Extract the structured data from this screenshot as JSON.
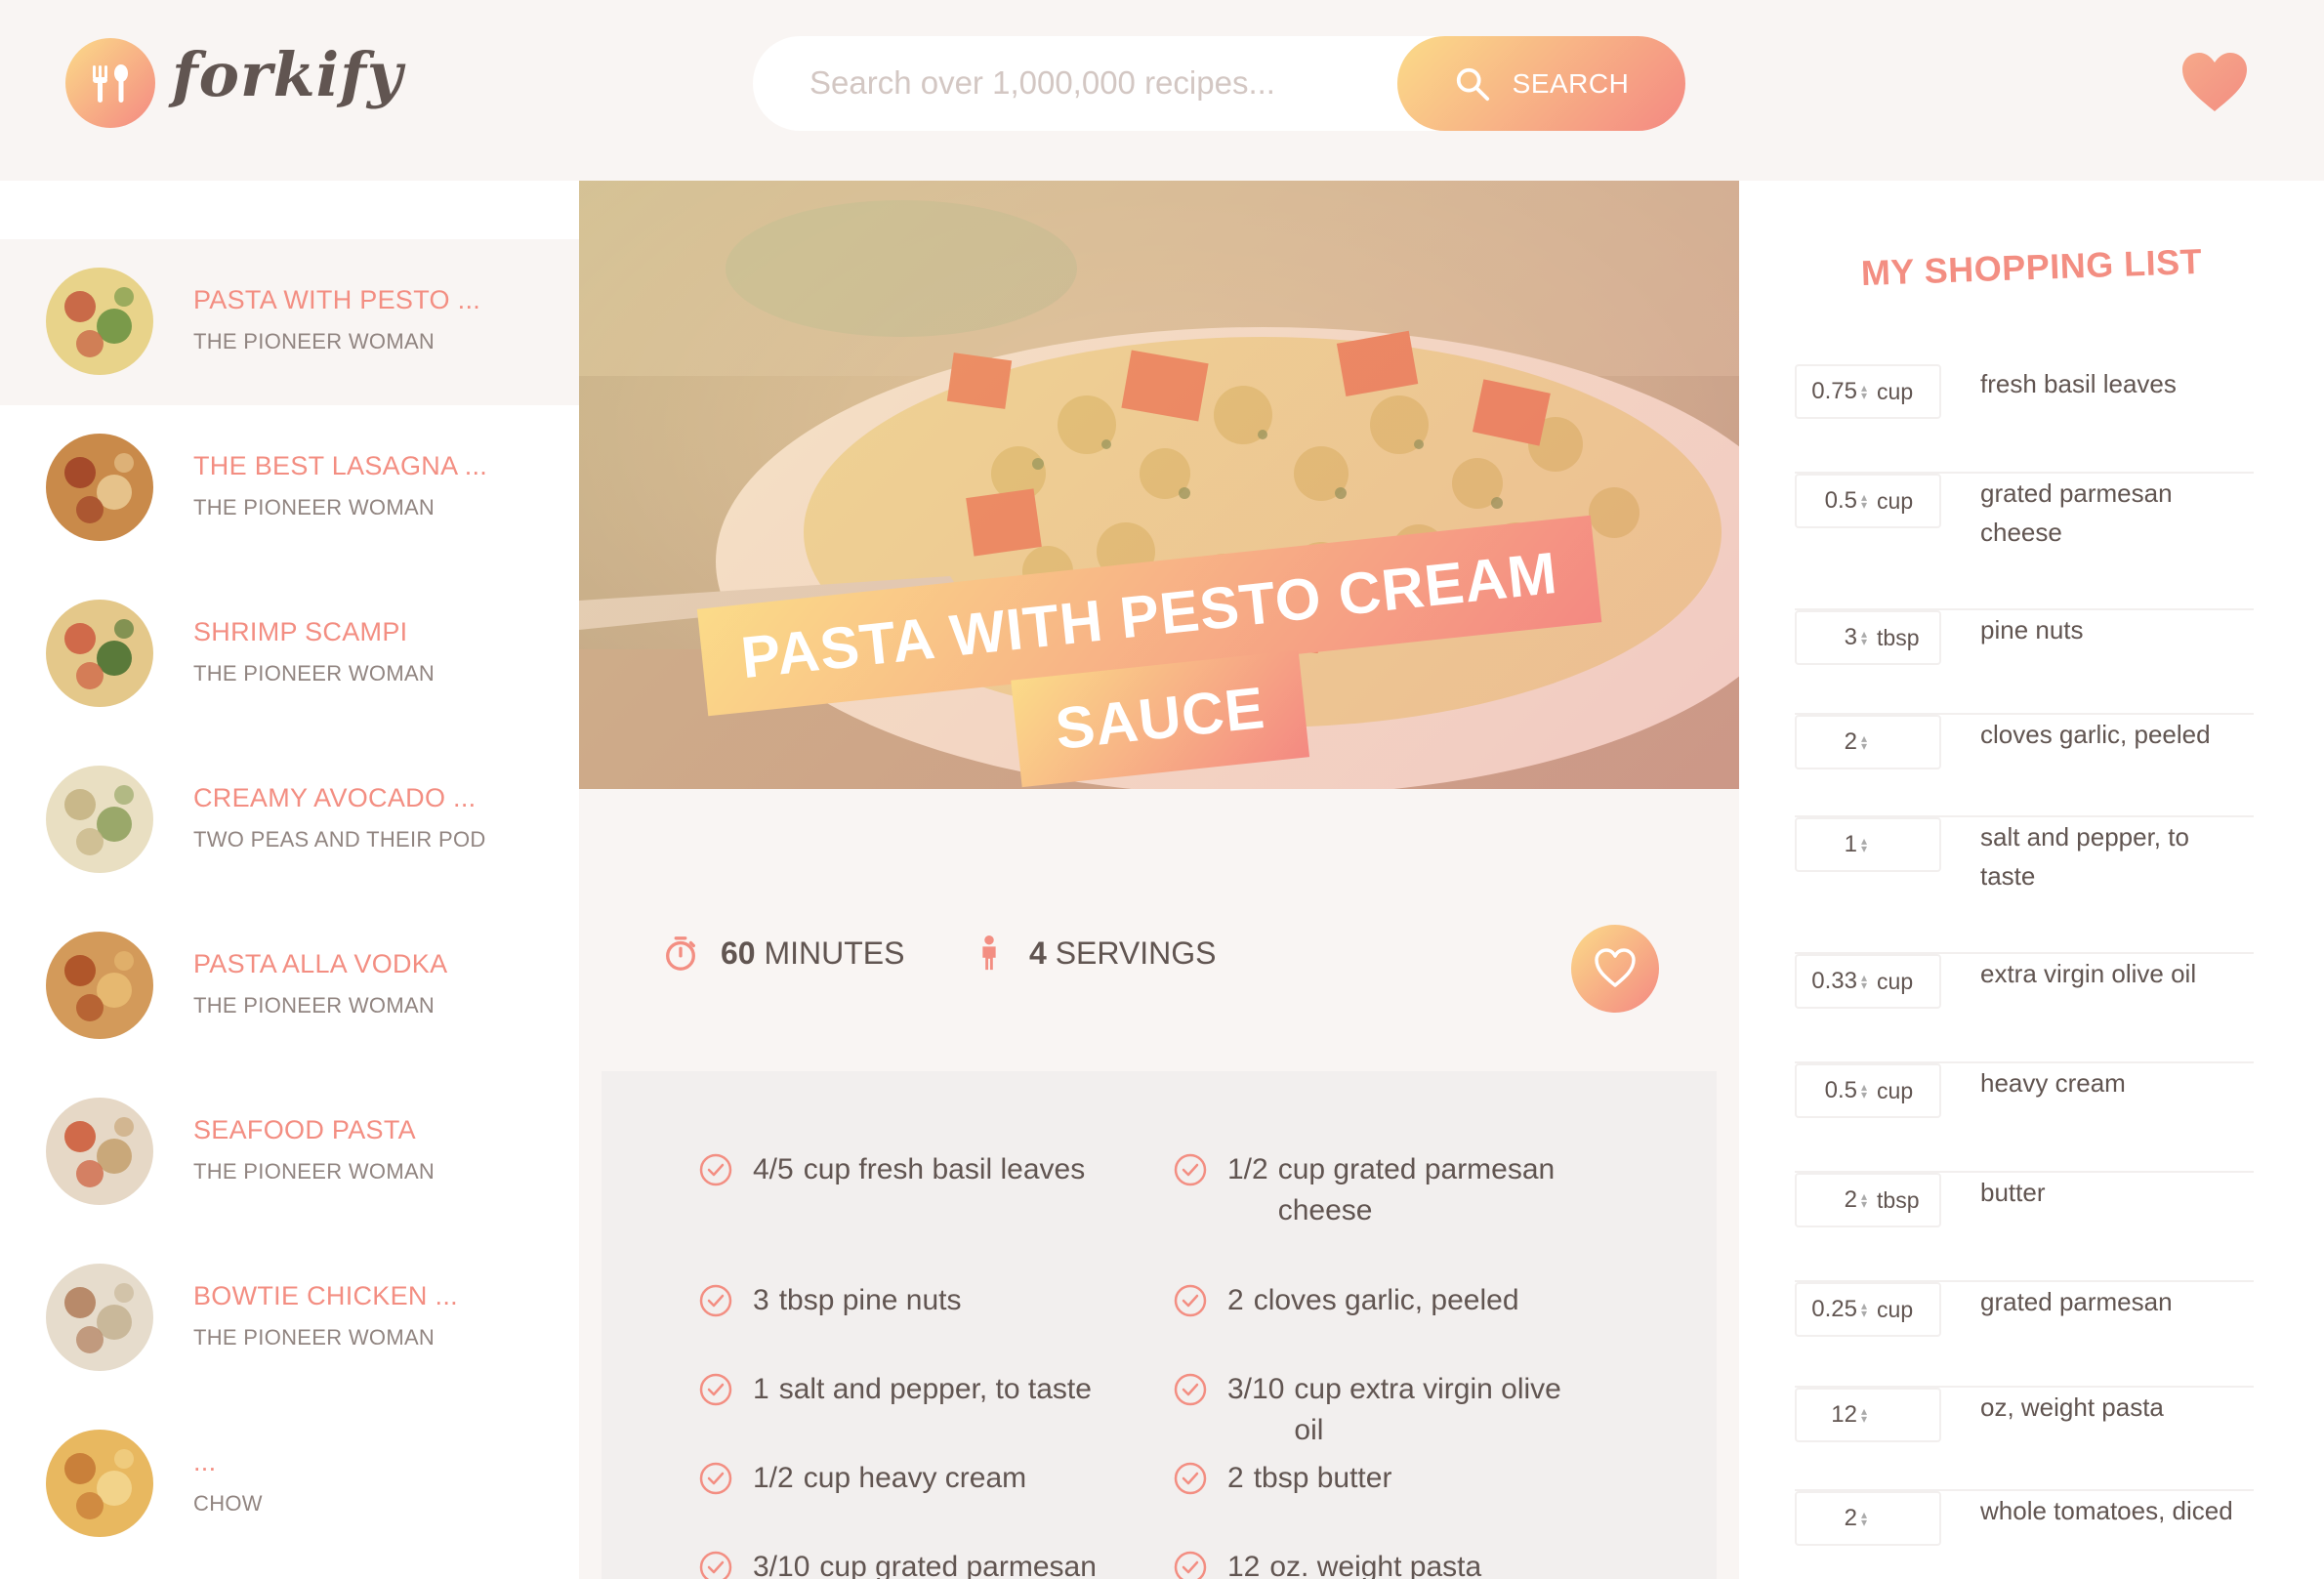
{
  "header": {
    "logo_text": "forkify",
    "search_placeholder": "Search over 1,000,000 recipes...",
    "search_button": "Search"
  },
  "results": [
    {
      "title": "Pasta with pesto ...",
      "author": "The Pioneer Woman",
      "active": true
    },
    {
      "title": "The Best Lasagna ...",
      "author": "The Pioneer Woman"
    },
    {
      "title": "Shrimp Scampi",
      "author": "The Pioneer Woman"
    },
    {
      "title": "Creamy Avocado ...",
      "author": "Two Peas and Their Pod"
    },
    {
      "title": "Pasta Alla Vodka",
      "author": "The Pioneer Woman"
    },
    {
      "title": "Seafood Pasta",
      "author": "The Pioneer Woman"
    },
    {
      "title": "Bowtie Chicken ...",
      "author": "The Pioneer Woman"
    },
    {
      "title": "...",
      "author": "Chow"
    }
  ],
  "recipe": {
    "title_line1": "Pasta with Pesto Cream",
    "title_line2": "Sauce",
    "minutes": "60",
    "minutes_label": "minutes",
    "servings": "4",
    "servings_label": "servings",
    "ingredients": [
      {
        "qty": "4/5",
        "text": "cup fresh basil leaves"
      },
      {
        "qty": "1/2",
        "text": "cup grated parmesan cheese"
      },
      {
        "qty": "3",
        "text": "tbsp pine nuts"
      },
      {
        "qty": "2",
        "text": "cloves garlic, peeled"
      },
      {
        "qty": "1",
        "text": "salt and pepper, to taste"
      },
      {
        "qty": "3/10",
        "text": "cup extra virgin olive oil"
      },
      {
        "qty": "1/2",
        "text": "cup heavy cream"
      },
      {
        "qty": "2",
        "text": "tbsp butter"
      },
      {
        "qty": "3/10",
        "text": "cup grated parmesan"
      },
      {
        "qty": "12",
        "text": "oz. weight pasta"
      }
    ]
  },
  "shopping": {
    "title": "My Shopping List",
    "items": [
      {
        "count": "0.75",
        "unit": "cup",
        "desc": "fresh basil leaves"
      },
      {
        "count": "0.5",
        "unit": "cup",
        "desc": "grated parmesan cheese"
      },
      {
        "count": "3",
        "unit": "tbsp",
        "desc": "pine nuts"
      },
      {
        "count": "2",
        "unit": "",
        "desc": "cloves garlic, peeled"
      },
      {
        "count": "1",
        "unit": "",
        "desc": "salt and pepper, to taste"
      },
      {
        "count": "0.33",
        "unit": "cup",
        "desc": "extra virgin olive oil"
      },
      {
        "count": "0.5",
        "unit": "cup",
        "desc": "heavy cream"
      },
      {
        "count": "2",
        "unit": "tbsp",
        "desc": "butter"
      },
      {
        "count": "0.25",
        "unit": "cup",
        "desc": "grated parmesan"
      },
      {
        "count": "12",
        "unit": "",
        "desc": "oz, weight pasta"
      },
      {
        "count": "2",
        "unit": "",
        "desc": "whole tomatoes, diced"
      }
    ]
  },
  "colors": {
    "accent": "#f38e82",
    "gradient_start": "#fbdb89",
    "gradient_end": "#f48982",
    "text": "#615551"
  }
}
